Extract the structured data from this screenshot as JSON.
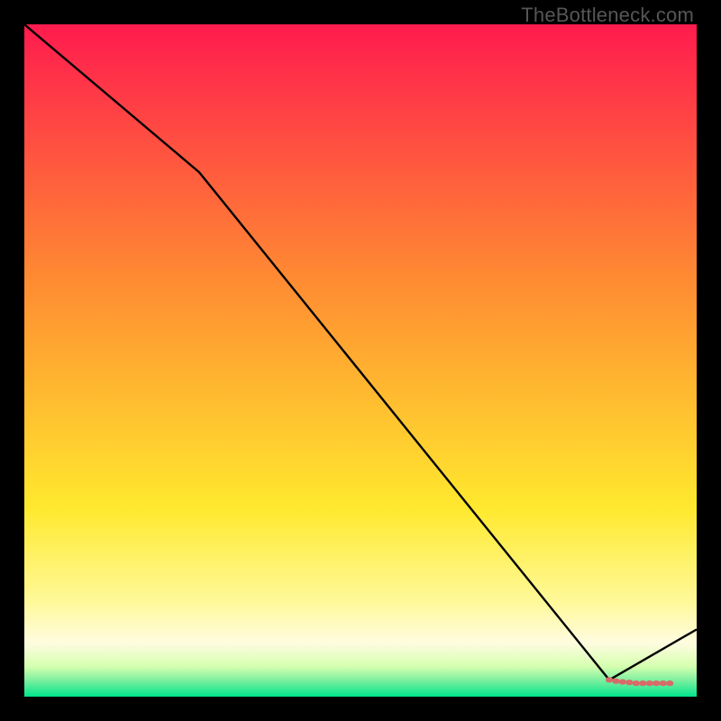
{
  "watermark": "TheBottleneck.com",
  "colors": {
    "top": "#ff1b4e",
    "yellow": "#ffe92e",
    "green": "#00e48b",
    "line": "#000000",
    "marker": "#d86a6a"
  },
  "chart_data": {
    "type": "line",
    "title": "",
    "xlabel": "",
    "ylabel": "",
    "xlim": [
      0,
      100
    ],
    "ylim": [
      0,
      100
    ],
    "grid": false,
    "series": [
      {
        "name": "curve",
        "x": [
          0,
          26,
          87,
          100
        ],
        "values": [
          100,
          78,
          2.5,
          10
        ]
      }
    ],
    "annotations": {
      "bottom_markers": {
        "x": [
          87,
          88,
          89,
          90,
          91,
          92,
          93,
          94,
          95,
          96
        ],
        "y": [
          2.5,
          2.3,
          2.2,
          2.1,
          2.0,
          2.0,
          2.0,
          2.0,
          2.0,
          2.0
        ]
      }
    }
  }
}
